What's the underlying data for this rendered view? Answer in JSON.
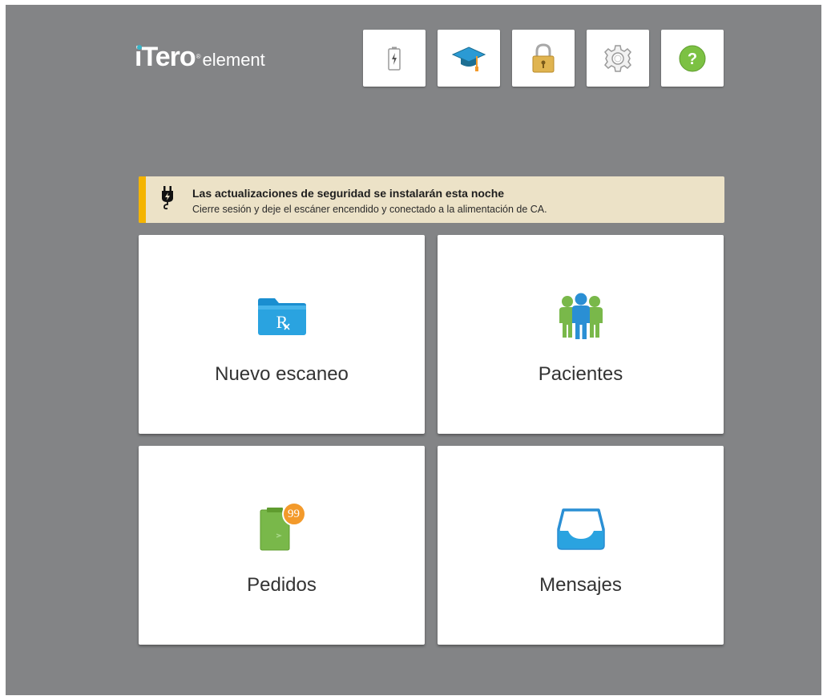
{
  "brand": {
    "logo_main": "Tero",
    "logo_i": "i",
    "logo_reg": "®",
    "logo_sub": "element"
  },
  "toolbar": {
    "buttons": [
      {
        "name": "battery",
        "icon": "battery-charging-icon"
      },
      {
        "name": "learning",
        "icon": "graduation-cap-icon"
      },
      {
        "name": "lock",
        "icon": "padlock-icon"
      },
      {
        "name": "settings",
        "icon": "gear-icon"
      },
      {
        "name": "help",
        "icon": "help-icon",
        "glyph": "?"
      }
    ]
  },
  "notification": {
    "title": "Las actualizaciones de seguridad se instalarán esta noche",
    "message": "Cierre sesión y deje el escáner encendido y conectado a la alimentación de CA.",
    "icon": "power-plug-icon",
    "accent": "#f4b400"
  },
  "tiles": [
    {
      "label": "Nuevo escaneo",
      "icon": "rx-folder-icon"
    },
    {
      "label": "Pacientes",
      "icon": "patients-group-icon"
    },
    {
      "label": "Pedidos",
      "icon": "orders-clipboard-icon",
      "badge": "99"
    },
    {
      "label": "Mensajes",
      "icon": "inbox-tray-icon"
    }
  ],
  "colors": {
    "background": "#838486",
    "help_green": "#7cc143",
    "badge_orange": "#f39a2b",
    "folder_blue": "#2aa3e0"
  }
}
